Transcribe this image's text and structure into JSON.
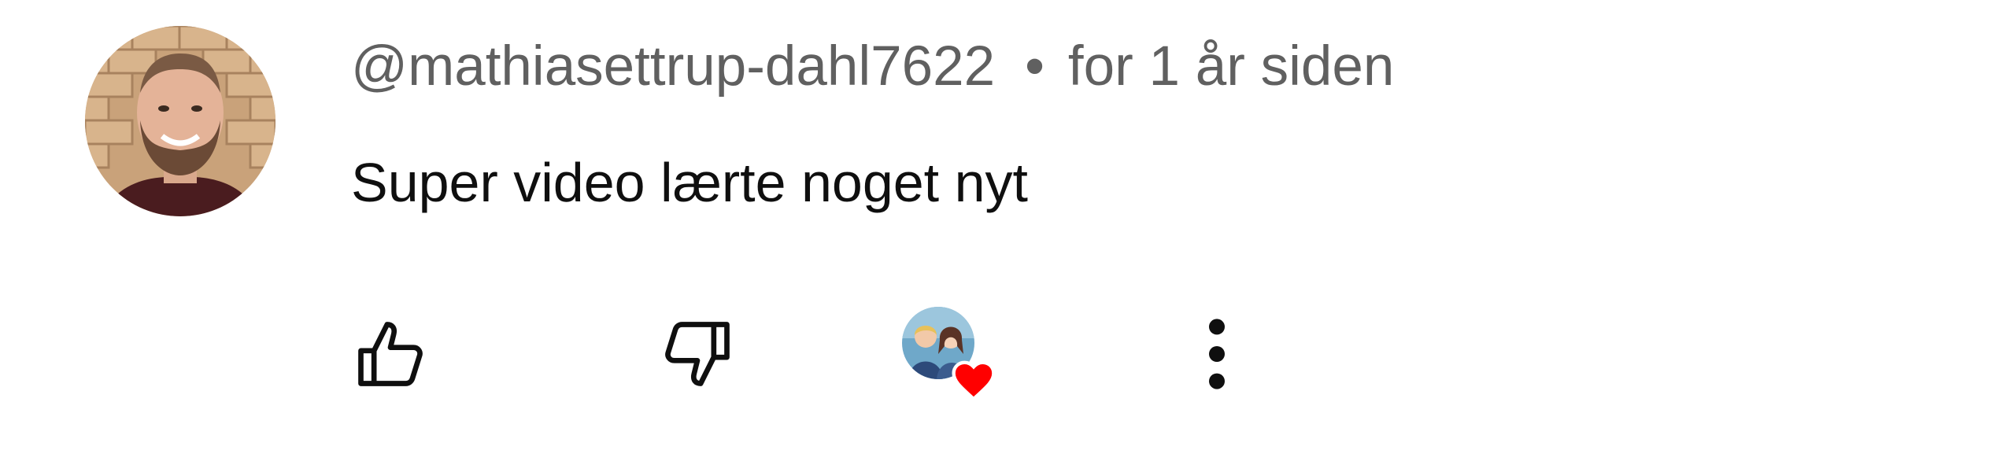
{
  "comment": {
    "author": "@mathiasettrup-dahl7622",
    "separator": "•",
    "timestamp": "for 1 år siden",
    "text": "Super video lærte noget nyt",
    "avatar_icon": "user-avatar-photo",
    "actions": {
      "like_icon": "thumbs-up-icon",
      "dislike_icon": "thumbs-down-icon",
      "creator_heart_icon": "creator-heart-icon",
      "more_icon": "more-vert-icon"
    },
    "colors": {
      "author_meta": "#606060",
      "text": "#0f0f0f",
      "heart": "#ff0000"
    }
  }
}
